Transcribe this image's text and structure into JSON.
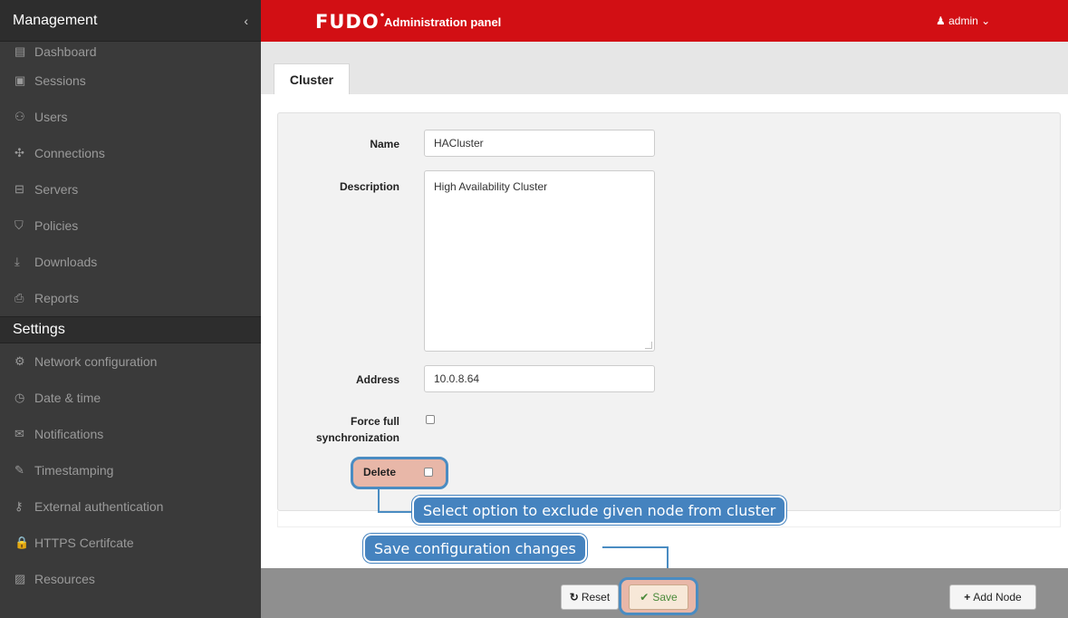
{
  "sidebar": {
    "management_title": "Management",
    "collapse_glyph": "‹",
    "management_items": [
      {
        "icon": "dashboard-icon",
        "glyph": "▤",
        "label": "Dashboard"
      },
      {
        "icon": "sessions-icon",
        "glyph": "▣",
        "label": "Sessions"
      },
      {
        "icon": "users-icon",
        "glyph": "⚇",
        "label": "Users"
      },
      {
        "icon": "connections-icon",
        "glyph": "✣",
        "label": "Connections"
      },
      {
        "icon": "servers-icon",
        "glyph": "⊟",
        "label": "Servers"
      },
      {
        "icon": "policies-icon",
        "glyph": "⛉",
        "label": "Policies"
      },
      {
        "icon": "downloads-icon",
        "glyph": "⤓",
        "label": "Downloads"
      },
      {
        "icon": "reports-icon",
        "glyph": "⎙",
        "label": "Reports"
      }
    ],
    "settings_title": "Settings",
    "settings_items": [
      {
        "icon": "network-configuration-icon",
        "glyph": "⚙",
        "label": "Network configuration"
      },
      {
        "icon": "clock-icon",
        "glyph": "◷",
        "label": "Date & time"
      },
      {
        "icon": "envelope-icon",
        "glyph": "✉",
        "label": "Notifications"
      },
      {
        "icon": "edit-icon",
        "glyph": "✎",
        "label": "Timestamping"
      },
      {
        "icon": "key-icon",
        "glyph": "⚷",
        "label": "External authentication"
      },
      {
        "icon": "lock-icon",
        "glyph": "🔒",
        "label": "HTTPS Certifcate"
      },
      {
        "icon": "picture-icon",
        "glyph": "▨",
        "label": "Resources"
      }
    ]
  },
  "header": {
    "logo_text": "FUDO",
    "logo_dot": "•",
    "app_title": "Administration panel",
    "user_label": "admin",
    "user_glyph": "♟",
    "user_chevron": "⌄",
    "accent_color": "#d20f14"
  },
  "tabs": [
    {
      "label": "Cluster"
    }
  ],
  "form": {
    "name_label": "Name",
    "name_value": "HACluster",
    "description_label": "Description",
    "description_value": "High Availability Cluster",
    "address_label": "Address",
    "address_value": "10.0.8.64",
    "force_sync_label_line1": "Force full",
    "force_sync_label_line2": "synchronization",
    "force_sync_checked": false,
    "delete_label": "Delete",
    "delete_checked": false
  },
  "callouts": {
    "delete_hint": "Select option to exclude given node from cluster",
    "save_hint": "Save configuration changes",
    "color": "#4583bf"
  },
  "actions": {
    "reset_label": "Reset",
    "reset_glyph": "↻",
    "save_label": "Save",
    "save_glyph": "✔",
    "add_node_label": "Add Node",
    "add_node_glyph": "+"
  }
}
